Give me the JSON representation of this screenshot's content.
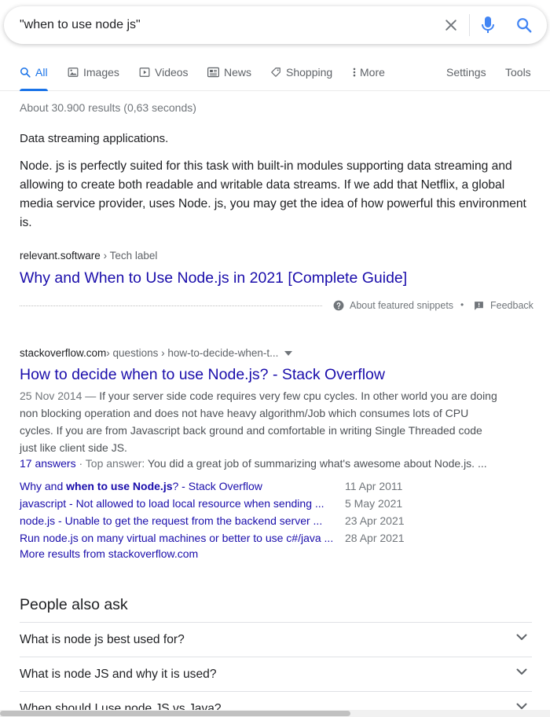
{
  "search": {
    "query": "\"when to use node js\"",
    "placeholder": ""
  },
  "tabs": [
    {
      "label": "All",
      "icon": "search-icon",
      "active": true
    },
    {
      "label": "Images",
      "icon": "image-icon"
    },
    {
      "label": "Videos",
      "icon": "video-icon"
    },
    {
      "label": "News",
      "icon": "news-icon"
    },
    {
      "label": "Shopping",
      "icon": "tag-icon"
    },
    {
      "label": "More",
      "icon": "more-vert-icon"
    },
    {
      "label": "Settings"
    },
    {
      "label": "Tools"
    }
  ],
  "stats": "About 30.900 results (0,63 seconds)",
  "featured": {
    "heading": "Data streaming applications.",
    "body": "Node. js is perfectly suited for this task with built-in modules supporting data streaming and allowing to create both readable and writable data streams. If we add that Netflix, a global media service provider, uses Node. js, you may get the idea of how powerful this environment is.",
    "site": "relevant.software",
    "crumb": " › Tech label",
    "title": "Why and When to Use Node.js in 2021 [Complete Guide]",
    "about": "About featured snippets",
    "separator": "•",
    "feedback": "Feedback"
  },
  "result2": {
    "site": "stackoverflow.com",
    "crumb": " › questions › how-to-decide-when-t...",
    "title": "How to decide when to use Node.js? - Stack Overflow",
    "date": "25 Nov 2014",
    "dash": " — ",
    "snippet": "If your server side code requires very few cpu cycles. In other world you are doing non blocking operation and does not have heavy algorithm/Job which consumes lots of CPU cycles. If you are from Javascript back ground and comfortable in writing Single Threaded code just like client side JS.",
    "answers": "17 answers",
    "top_label": " · Top answer: ",
    "top_answer": "You did a great job of summarizing what's awesome about Node.js. ...",
    "sublinks": [
      {
        "pre": "Why and ",
        "bold": "when to use Node.js",
        "post": "? - Stack Overflow",
        "date": "11 Apr 2011"
      },
      {
        "pre": "javascript - Not allowed to load local resource when sending ...",
        "bold": "",
        "post": "",
        "date": "5 May 2021"
      },
      {
        "pre": "node.js - Unable to get the request from the backend server ...",
        "bold": "",
        "post": "",
        "date": "23 Apr 2021"
      },
      {
        "pre": "Run node.js on many virtual machines or better to use c#/java ...",
        "bold": "",
        "post": "",
        "date": "28 Apr 2021"
      }
    ],
    "more": "More results from stackoverflow.com"
  },
  "paa": {
    "heading": "People also ask",
    "questions": [
      "What is node js best used for?",
      "What is node JS and why it is used?",
      "When should I use node JS vs Java?"
    ]
  },
  "colors": {
    "link": "#1a0dab",
    "accent": "#1a73e8",
    "muted": "#70757a"
  }
}
